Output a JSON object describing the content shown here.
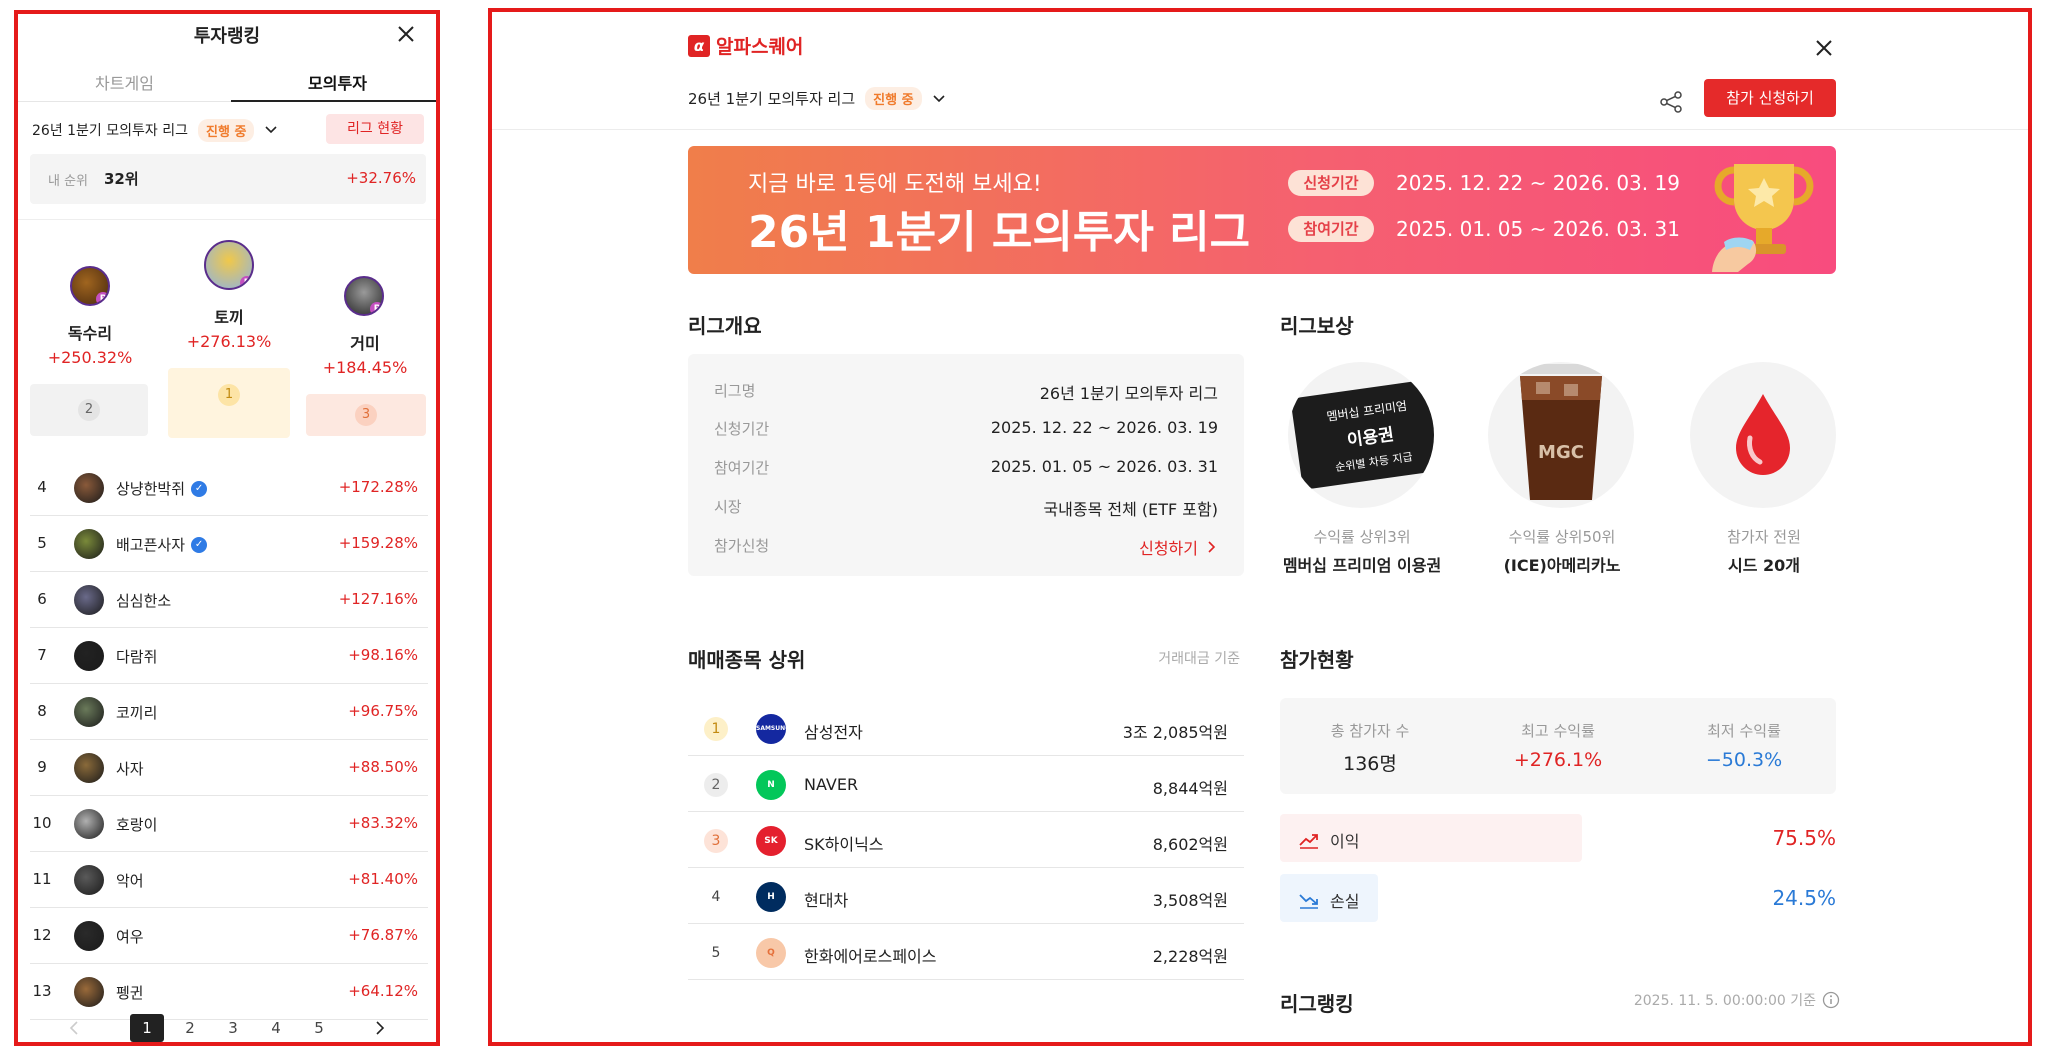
{
  "left": {
    "title": "투자랭킹",
    "tabs": [
      {
        "label": "차트게임"
      },
      {
        "label": "모의투자"
      }
    ],
    "league": {
      "name": "26년 1분기 모의투자 리그",
      "status": "진행 중",
      "status_button": "리그 현황"
    },
    "my_rank": {
      "label": "내 순위",
      "rank": "32위",
      "return": "+32.76%"
    },
    "podium": [
      {
        "rank": "1",
        "name": "토끼",
        "return": "+276.13%"
      },
      {
        "rank": "2",
        "name": "독수리",
        "return": "+250.32%"
      },
      {
        "rank": "3",
        "name": "거미",
        "return": "+184.45%"
      }
    ],
    "rows": [
      {
        "rank": "4",
        "name": "상냥한박쥐",
        "return": "+172.28%",
        "verified": true
      },
      {
        "rank": "5",
        "name": "배고픈사자",
        "return": "+159.28%",
        "verified": true
      },
      {
        "rank": "6",
        "name": "심심한소",
        "return": "+127.16%",
        "verified": false
      },
      {
        "rank": "7",
        "name": "다람쥐",
        "return": "+98.16%",
        "verified": false
      },
      {
        "rank": "8",
        "name": "코끼리",
        "return": "+96.75%",
        "verified": false
      },
      {
        "rank": "9",
        "name": "사자",
        "return": "+88.50%",
        "verified": false
      },
      {
        "rank": "10",
        "name": "호랑이",
        "return": "+83.32%",
        "verified": false
      },
      {
        "rank": "11",
        "name": "악어",
        "return": "+81.40%",
        "verified": false
      },
      {
        "rank": "12",
        "name": "여우",
        "return": "+76.87%",
        "verified": false
      },
      {
        "rank": "13",
        "name": "펭귄",
        "return": "+64.12%",
        "verified": false
      }
    ],
    "pagination": {
      "pages": [
        "1",
        "2",
        "3",
        "4",
        "5"
      ],
      "current": "1"
    }
  },
  "right": {
    "brand": "알파스퀘어",
    "brand_logo_glyph": "α",
    "league": {
      "name": "26년 1분기 모의투자 리그",
      "status": "진행 중"
    },
    "apply_button": "참가 신청하기",
    "banner": {
      "subtitle": "지금 바로 1등에 도전해 보세요!",
      "title": "26년 1분기 모의투자 리그",
      "apply_label": "신청기간",
      "apply_period": "2025. 12. 22 ~ 2026. 03. 19",
      "join_label": "참여기간",
      "join_period": "2025. 01. 05 ~ 2026. 03. 31"
    },
    "overview": {
      "title": "리그개요",
      "rows": [
        {
          "key": "리그명",
          "value": "26년 1분기 모의투자 리그"
        },
        {
          "key": "신청기간",
          "value": "2025. 12. 22 ~ 2026. 03. 19"
        },
        {
          "key": "참여기간",
          "value": "2025. 01. 05 ~ 2026. 03. 31"
        },
        {
          "key": "시장",
          "value": "국내종목 전체 (ETF 포함)"
        },
        {
          "key": "참가신청",
          "value": "신청하기"
        }
      ]
    },
    "rewards": {
      "title": "리그보상",
      "ticket": {
        "line1": "멤버십 프리미엄",
        "line2": "이용권",
        "line3": "순위별 차등 지급"
      },
      "coffee_logo": "MGC",
      "items": [
        {
          "condition": "수익률 상위3위",
          "name": "멤버십 프리미엄 이용권"
        },
        {
          "condition": "수익률 상위50위",
          "name": "(ICE)아메리카노"
        },
        {
          "condition": "참가자 전원",
          "name": "시드 20개"
        }
      ]
    },
    "top_stocks": {
      "title": "매매종목 상위",
      "note": "거래대금 기준",
      "rows": [
        {
          "rank": "1",
          "name": "삼성전자",
          "amount": "3조 2,085억원",
          "logo": "SAMSUNG",
          "color": "#1428a0"
        },
        {
          "rank": "2",
          "name": "NAVER",
          "amount": "8,844억원",
          "logo": "N",
          "color": "#03c75a"
        },
        {
          "rank": "3",
          "name": "SK하이닉스",
          "amount": "8,602억원",
          "logo": "SK",
          "color": "#e4202e"
        },
        {
          "rank": "4",
          "name": "현대차",
          "amount": "3,508억원",
          "logo": "H",
          "color": "#002c5f"
        },
        {
          "rank": "5",
          "name": "한화에어로스페이스",
          "amount": "2,228억원",
          "logo": "Q",
          "color": "#f8c8a8"
        }
      ]
    },
    "participation": {
      "title": "참가현황",
      "stats": [
        {
          "label": "총 참가자 수",
          "value": "136명",
          "color": "#222222"
        },
        {
          "label": "최고 수익률",
          "value": "+276.1%",
          "color": "#e02424"
        },
        {
          "label": "최저 수익률",
          "value": "−50.3%",
          "color": "#2a7ad6"
        }
      ],
      "profit": {
        "label": "이익",
        "value": "75.5%",
        "fraction": 0.755
      },
      "loss": {
        "label": "손실",
        "value": "24.5%",
        "fraction": 0.245
      }
    },
    "ranking": {
      "title": "리그랭킹",
      "note": "2025. 11. 5. 00:00:00 기준"
    }
  },
  "colors": {
    "accent": "#e02424",
    "banner_start": "#f07e4a",
    "banner_end": "#f84c7e",
    "loss_blue": "#2a7ad6"
  }
}
